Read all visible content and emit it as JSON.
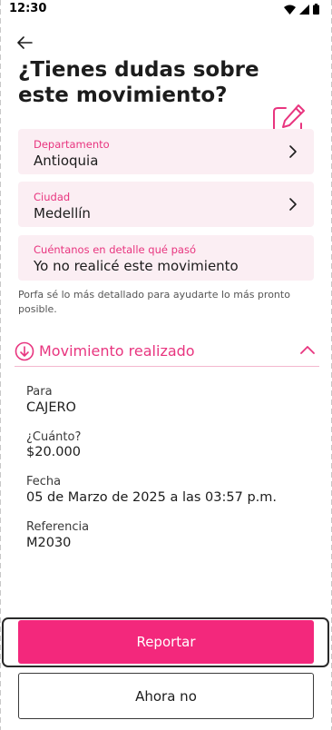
{
  "status_bar": {
    "time": "12:30",
    "icons": [
      "wifi-icon",
      "signal-icon",
      "battery-icon"
    ]
  },
  "header": {
    "back_icon": "arrow-left-icon",
    "title": "¿Tienes dudas sobre este movimiento?",
    "edit_icon": "edit-pencil-icon"
  },
  "form": {
    "department": {
      "label": "Departamento",
      "value": "Antioquia"
    },
    "city": {
      "label": "Ciudad",
      "value": "Medellín"
    },
    "detail": {
      "label": "Cuéntanos en detalle qué pasó",
      "value": "Yo no realicé este movimiento"
    },
    "helper_text": "Porfa sé lo más detallado para ayudarte lo más pronto posible."
  },
  "movement": {
    "section_title": "Movimiento realizado",
    "fields": [
      {
        "label": "Para",
        "value": "CAJERO"
      },
      {
        "label": "¿Cuánto?",
        "value": "$20.000"
      },
      {
        "label": "Fecha",
        "value": "05 de Marzo de 2025 a las 03:57 p.m."
      },
      {
        "label": "Referencia",
        "value": "M2030"
      }
    ]
  },
  "actions": {
    "primary_label": "Reportar",
    "secondary_label": "Ahora no"
  },
  "colors": {
    "accent": "#e8357f",
    "primary_button": "#f3287c",
    "field_background": "#fbeef3"
  }
}
